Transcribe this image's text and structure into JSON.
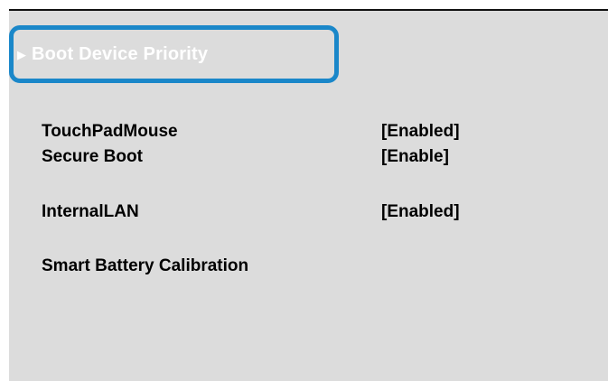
{
  "boot_device_priority": {
    "arrow": "▶",
    "label": "Boot Device Priority"
  },
  "settings": [
    {
      "name": "TouchPadMouse",
      "value": "[Enabled]"
    },
    {
      "name": "Secure Boot",
      "value": "[Enable]"
    },
    {
      "name": "InternalLAN",
      "value": "[Enabled]"
    },
    {
      "name": "Smart Battery Calibration",
      "value": ""
    }
  ],
  "colors": {
    "background": "#dcdcdc",
    "highlight_border": "#1a87c9",
    "highlight_text": "#ffffff",
    "text": "#000000"
  }
}
